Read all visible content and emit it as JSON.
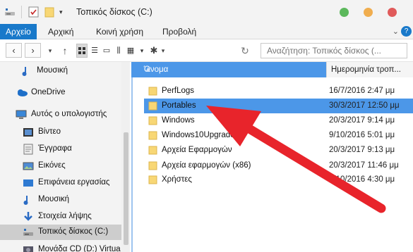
{
  "window": {
    "title": "Τοπικός δίσκος (C:)",
    "traffic_lights": [
      "#5cb85c",
      "#f0ad4e",
      "#e05a5a"
    ]
  },
  "ribbon": {
    "tabs": [
      "Αρχείο",
      "Αρχική",
      "Κοινή χρήση",
      "Προβολή"
    ],
    "help_label": "?"
  },
  "toolbar": {
    "search_placeholder": "Αναζήτηση: Τοπικός δίσκος (..."
  },
  "sidebar": {
    "items": [
      {
        "label": "Μουσική",
        "icon": "music-icon"
      },
      {
        "label": "OneDrive",
        "icon": "cloud-icon"
      },
      {
        "label": "Αυτός ο υπολογιστής",
        "icon": "computer-icon"
      },
      {
        "label": "Βίντεο",
        "icon": "video-icon"
      },
      {
        "label": "Έγγραφα",
        "icon": "document-icon"
      },
      {
        "label": "Εικόνες",
        "icon": "pictures-icon"
      },
      {
        "label": "Επιφάνεια εργασίας",
        "icon": "desktop-icon"
      },
      {
        "label": "Μουσική",
        "icon": "music-icon"
      },
      {
        "label": "Στοιχεία λήψης",
        "icon": "download-icon"
      },
      {
        "label": "Τοπικός δίσκος (C:)",
        "icon": "drive-icon",
        "selected": true
      },
      {
        "label": "Μονάδα CD (D:) Virtua",
        "icon": "cd-drive-icon"
      }
    ]
  },
  "content": {
    "columns": {
      "name": "Όνομα",
      "date": "Ημερομηνία τροπ..."
    },
    "rows": [
      {
        "name": "PerfLogs",
        "date": "16/7/2016 2:47 μμ"
      },
      {
        "name": "Portables",
        "date": "30/3/2017 12:50 μμ",
        "selected": true
      },
      {
        "name": "Windows",
        "date": "20/3/2017 9:14 μμ"
      },
      {
        "name": "Windows10Upgrade",
        "date": "9/10/2016 5:01 μμ"
      },
      {
        "name": "Αρχεία Εφαρμογών",
        "date": "20/3/2017 9:13 μμ"
      },
      {
        "name": "Αρχεία εφαρμογών (x86)",
        "date": "20/3/2017 11:46 μμ"
      },
      {
        "name": "Χρήστες",
        "date": "9/10/2016 4:30 μμ"
      }
    ]
  },
  "colors": {
    "accent": "#1979ca",
    "selection": "#4c97e8",
    "folder": "#f8d775",
    "annotation_arrow": "#e8242b"
  }
}
